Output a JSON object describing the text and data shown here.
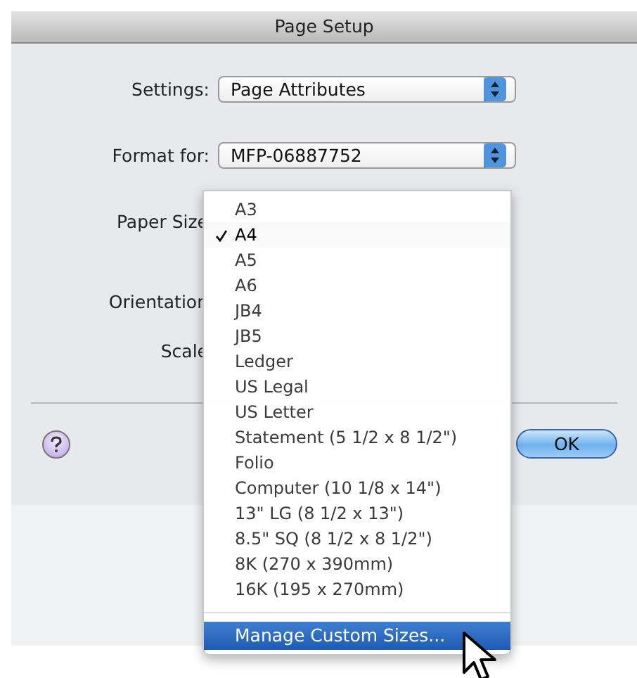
{
  "window": {
    "title": "Page Setup"
  },
  "fields": [
    {
      "label": "Settings:",
      "value": "Page Attributes"
    },
    {
      "label": "Format for:",
      "value": "MFP-06887752"
    }
  ],
  "labels": [
    {
      "text": "Paper Size"
    },
    {
      "text": "Orientation"
    },
    {
      "text": "Scale"
    }
  ],
  "menu": {
    "items": [
      {
        "label": "A3",
        "selected": false
      },
      {
        "label": "A4",
        "selected": true
      },
      {
        "label": "A5",
        "selected": false
      },
      {
        "label": "A6",
        "selected": false
      },
      {
        "label": "JB4",
        "selected": false
      },
      {
        "label": "JB5",
        "selected": false
      },
      {
        "label": "Ledger",
        "selected": false
      },
      {
        "label": "US Legal",
        "selected": false
      },
      {
        "label": "US Letter",
        "selected": false
      },
      {
        "label": "Statement (5 1/2 x 8 1/2\")",
        "selected": false
      },
      {
        "label": "Folio",
        "selected": false
      },
      {
        "label": "Computer (10 1/8 x 14\")",
        "selected": false
      },
      {
        "label": "13\" LG (8 1/2 x 13\")",
        "selected": false
      },
      {
        "label": "8.5\" SQ (8 1/2 x 8 1/2\")",
        "selected": false
      },
      {
        "label": "8K (270 x 390mm)",
        "selected": false
      },
      {
        "label": "16K (195 x 270mm)",
        "selected": false
      }
    ],
    "footer_item": {
      "label": "Manage Custom Sizes...",
      "highlighted": true
    }
  },
  "buttons": [
    {
      "label": "OK",
      "default": true
    }
  ]
}
